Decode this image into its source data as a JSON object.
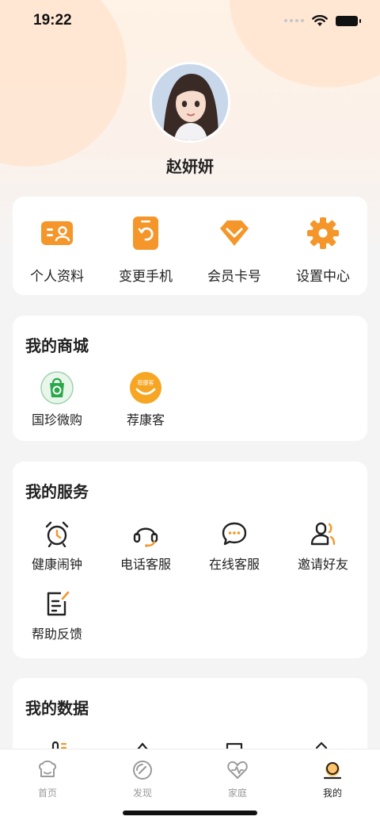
{
  "status_bar": {
    "time": "19:22"
  },
  "profile": {
    "name": "赵妍妍"
  },
  "quick_actions": [
    {
      "label": "个人资料",
      "icon": "profile-card-icon"
    },
    {
      "label": "变更手机",
      "icon": "phone-change-icon"
    },
    {
      "label": "会员卡号",
      "icon": "diamond-icon"
    },
    {
      "label": "设置中心",
      "icon": "gear-icon"
    }
  ],
  "mall": {
    "title": "我的商城",
    "items": [
      {
        "label": "国珍微购",
        "icon": "shopping-bag-icon"
      },
      {
        "label": "荐康客",
        "icon": "smile-logo-icon",
        "logo_text": "荐康客"
      }
    ]
  },
  "services": {
    "title": "我的服务",
    "items": [
      {
        "label": "健康闹钟",
        "icon": "alarm-clock-icon"
      },
      {
        "label": "电话客服",
        "icon": "headset-icon"
      },
      {
        "label": "在线客服",
        "icon": "chat-bubble-icon"
      },
      {
        "label": "邀请好友",
        "icon": "invite-user-icon"
      },
      {
        "label": "帮助反馈",
        "icon": "feedback-note-icon"
      }
    ]
  },
  "data_section": {
    "title": "我的数据"
  },
  "tabs": [
    {
      "label": "首页",
      "icon": "home-icon",
      "active": false
    },
    {
      "label": "发现",
      "icon": "compass-icon",
      "active": false
    },
    {
      "label": "家庭",
      "icon": "family-heart-icon",
      "active": false
    },
    {
      "label": "我的",
      "icon": "me-icon",
      "active": true
    }
  ],
  "colors": {
    "accent": "#f5962a",
    "accent_light": "#ffc46b",
    "green": "#2aa84a"
  }
}
